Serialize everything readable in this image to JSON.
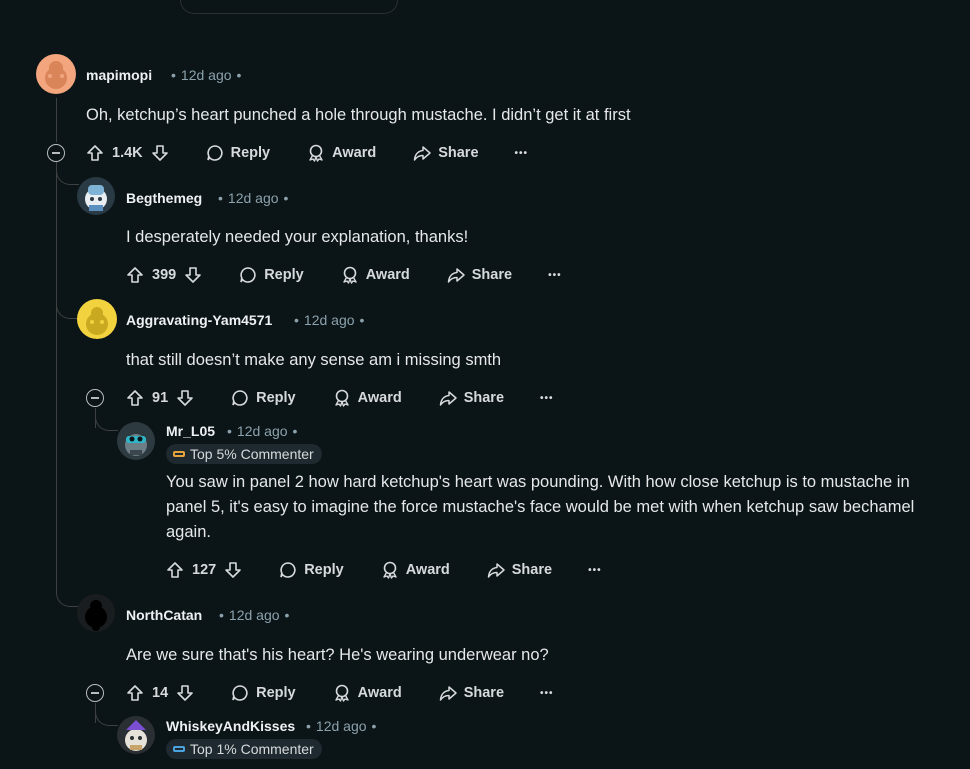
{
  "comments": [
    {
      "username": "mapimopi",
      "time": "12d ago",
      "body": "Oh, ketchup’s heart punched a hole through mustache. I didn’t get it at first",
      "score": "1.4K"
    },
    {
      "username": "Begthemeg",
      "time": "12d ago",
      "body": "I desperately needed your explanation, thanks!",
      "score": "399"
    },
    {
      "username": "Aggravating-Yam4571",
      "time": "12d ago",
      "body": "that still doesn’t make any sense am i missing smth",
      "score": "91"
    },
    {
      "username": "Mr_L05",
      "time": "12d ago",
      "badge": "Top 5% Commenter",
      "body": "You saw in panel 2 how hard ketchup's heart was pounding. With how close ketchup is to mustache in panel 5, it's easy to imagine the force mustache's face would be met with when ketchup saw bechamel again.",
      "score": "127"
    },
    {
      "username": "NorthCatan",
      "time": "12d ago",
      "body": "Are we sure that's his heart? He's wearing underwear no?",
      "score": "14"
    },
    {
      "username": "WhiskeyAndKisses",
      "time": "12d ago",
      "badge": "Top 1% Commenter"
    }
  ],
  "labels": {
    "reply": "Reply",
    "award": "Award",
    "share": "Share",
    "more": "•••",
    "dot": "•"
  },
  "colors": {
    "background": "#0b1416",
    "thread_line": "#3e4142",
    "meta": "#8ba2ad",
    "badge_bg": "#1e2a2f"
  }
}
